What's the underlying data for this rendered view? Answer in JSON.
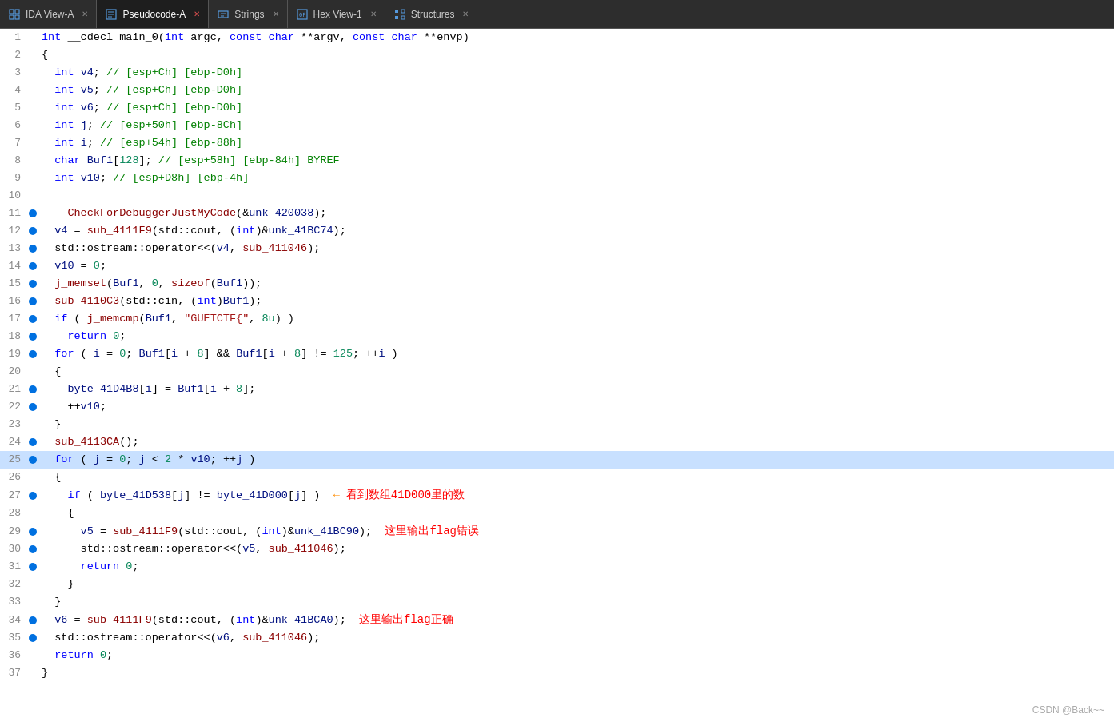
{
  "tabs": [
    {
      "id": "ida-view",
      "label": "IDA View-A",
      "icon": "grid",
      "active": false,
      "closable": true
    },
    {
      "id": "pseudocode",
      "label": "Pseudocode-A",
      "icon": "doc",
      "active": true,
      "closable": true
    },
    {
      "id": "strings",
      "label": "Strings",
      "icon": "table",
      "active": false,
      "closable": true
    },
    {
      "id": "hex-view",
      "label": "Hex View-1",
      "icon": "hex",
      "active": false,
      "closable": true
    },
    {
      "id": "structures",
      "label": "Structures",
      "icon": "struct",
      "active": false,
      "closable": true
    }
  ],
  "watermark": "CSDN @Back~~",
  "highlighted_line": 25,
  "breakpoint_lines": [
    11,
    12,
    13,
    14,
    15,
    16,
    17,
    18,
    19,
    21,
    22,
    24,
    25,
    27,
    29,
    30,
    31,
    34,
    35
  ]
}
